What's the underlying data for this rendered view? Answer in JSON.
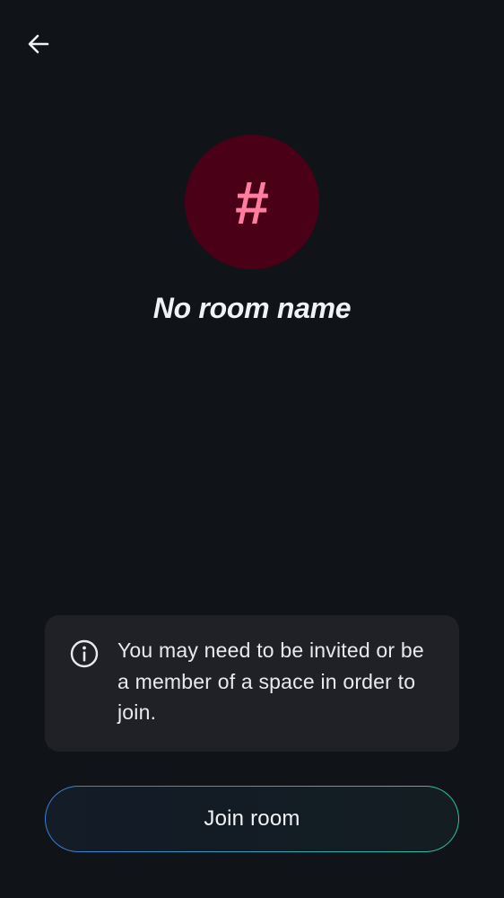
{
  "header": {
    "back_icon": "arrow-left-icon"
  },
  "room": {
    "avatar_glyph": "#",
    "avatar_bg_color": "#4a0016",
    "avatar_glyph_color": "#ff7ea0",
    "name": "No room name"
  },
  "notice": {
    "icon": "info-icon",
    "text": "You may need to be invited or be a member of a space in order to join."
  },
  "actions": {
    "join_label": "Join room"
  }
}
